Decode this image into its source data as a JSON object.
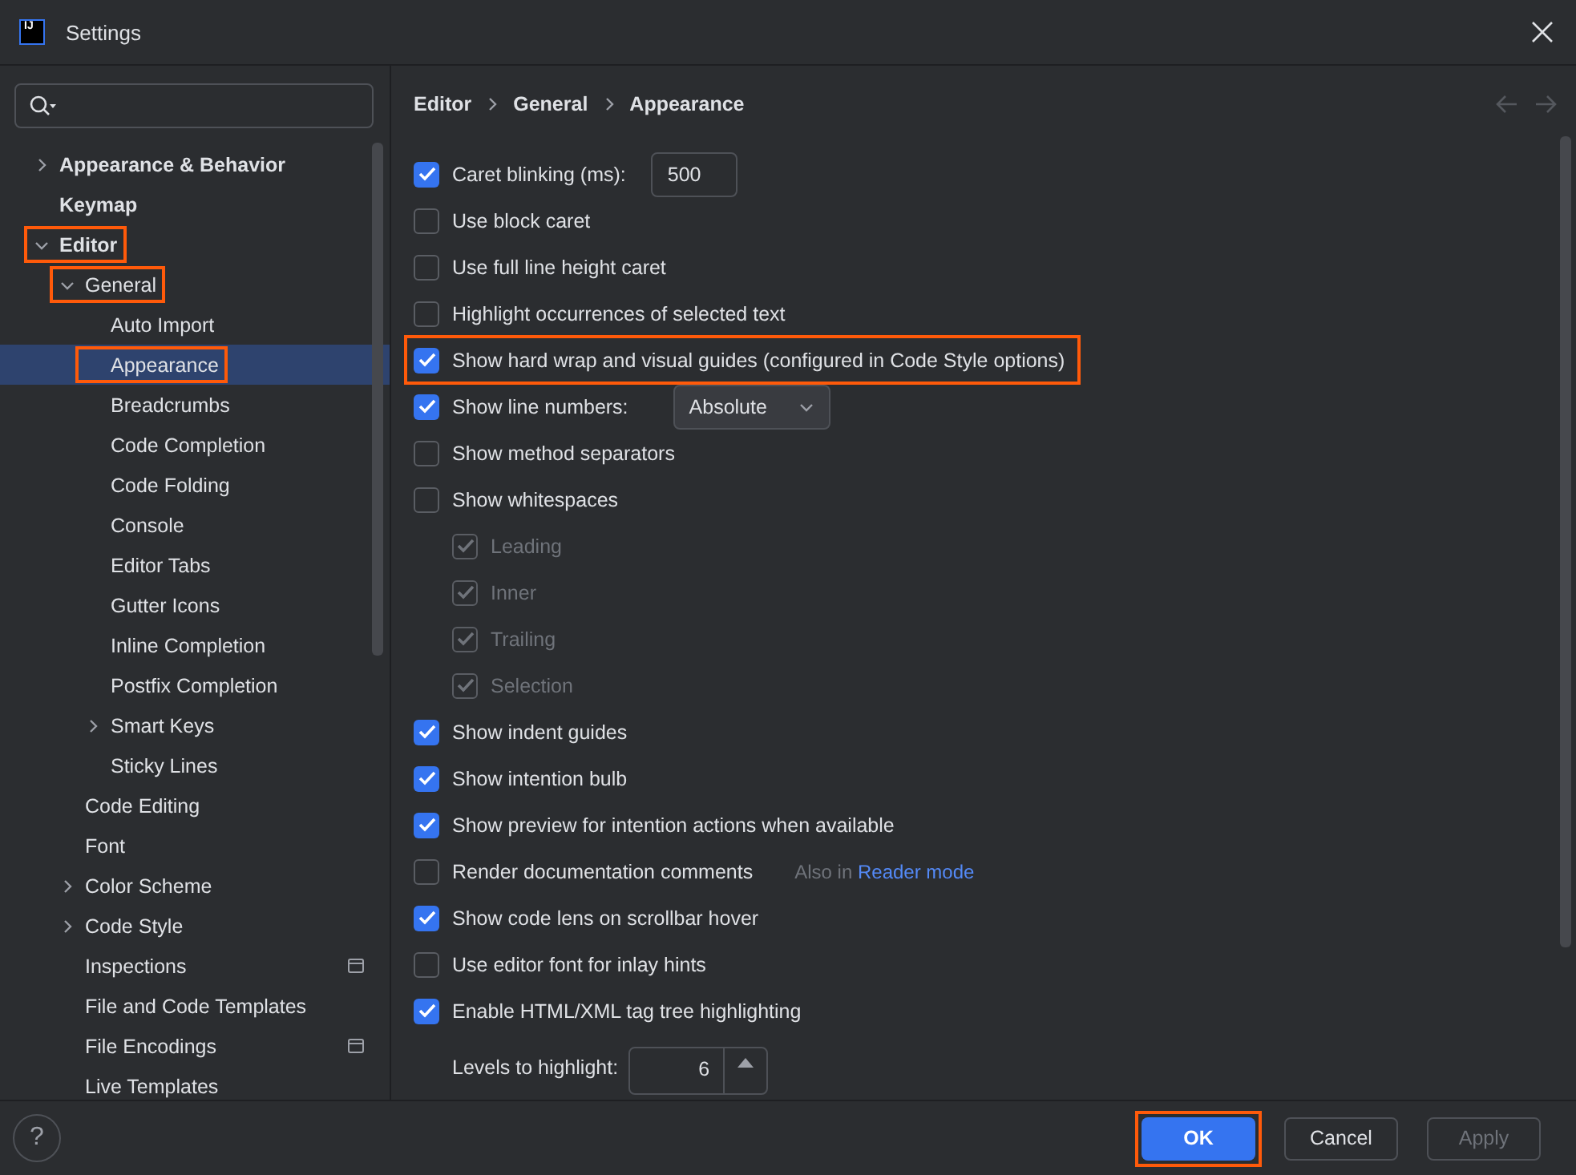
{
  "window": {
    "logo": "IJ",
    "title": "Settings"
  },
  "sidebar": {
    "items": [
      {
        "label": "Appearance & Behavior",
        "expanded": false,
        "selected": false,
        "highlighted": false
      },
      {
        "label": "Keymap",
        "selected": false,
        "highlighted": false
      },
      {
        "label": "Editor",
        "expanded": true,
        "selected": false,
        "highlighted": true,
        "children": [
          {
            "label": "General",
            "expanded": true,
            "selected": false,
            "highlighted": true,
            "children": [
              {
                "label": "Auto Import",
                "selected": false,
                "highlighted": false
              },
              {
                "label": "Appearance",
                "selected": true,
                "highlighted": true
              },
              {
                "label": "Breadcrumbs",
                "selected": false,
                "highlighted": false
              },
              {
                "label": "Code Completion",
                "selected": false,
                "highlighted": false
              },
              {
                "label": "Code Folding",
                "selected": false,
                "highlighted": false
              },
              {
                "label": "Console",
                "selected": false,
                "highlighted": false
              },
              {
                "label": "Editor Tabs",
                "selected": false,
                "highlighted": false
              },
              {
                "label": "Gutter Icons",
                "selected": false,
                "highlighted": false
              },
              {
                "label": "Inline Completion",
                "selected": false,
                "highlighted": false
              },
              {
                "label": "Postfix Completion",
                "selected": false,
                "highlighted": false
              },
              {
                "label": "Smart Keys",
                "expanded": false,
                "selected": false,
                "highlighted": false
              },
              {
                "label": "Sticky Lines",
                "selected": false,
                "highlighted": false
              }
            ]
          },
          {
            "label": "Code Editing",
            "selected": false,
            "highlighted": false
          },
          {
            "label": "Font",
            "selected": false,
            "highlighted": false
          },
          {
            "label": "Color Scheme",
            "expanded": false,
            "selected": false,
            "highlighted": false
          },
          {
            "label": "Code Style",
            "expanded": false,
            "selected": false,
            "highlighted": false
          },
          {
            "label": "Inspections",
            "selected": false,
            "highlighted": false,
            "scoped": true
          },
          {
            "label": "File and Code Templates",
            "selected": false,
            "highlighted": false
          },
          {
            "label": "File Encodings",
            "selected": false,
            "highlighted": false,
            "scoped": true
          },
          {
            "label": "Live Templates",
            "selected": false,
            "highlighted": false
          }
        ]
      }
    ]
  },
  "breadcrumbs": [
    "Editor",
    "General",
    "Appearance"
  ],
  "options": [
    {
      "kind": "checkbox",
      "label": "Caret blinking (ms):",
      "checked": true,
      "highlighted": false,
      "value": "500"
    },
    {
      "kind": "checkbox",
      "label": "Use block caret",
      "checked": false,
      "highlighted": false
    },
    {
      "kind": "checkbox",
      "label": "Use full line height caret",
      "checked": false,
      "highlighted": false
    },
    {
      "kind": "checkbox",
      "label": "Highlight occurrences of selected text",
      "checked": false,
      "highlighted": false
    },
    {
      "kind": "checkbox",
      "label": "Show hard wrap and visual guides (configured in Code Style options)",
      "checked": true,
      "highlighted": true
    },
    {
      "kind": "checkbox",
      "label": "Show line numbers:",
      "checked": true,
      "highlighted": false,
      "select": "Absolute"
    },
    {
      "kind": "checkbox",
      "label": "Show method separators",
      "checked": false,
      "highlighted": false
    },
    {
      "kind": "checkbox",
      "label": "Show whitespaces",
      "checked": false,
      "highlighted": false,
      "children": [
        {
          "label": "Leading",
          "checked": true,
          "disabled": true
        },
        {
          "label": "Inner",
          "checked": true,
          "disabled": true
        },
        {
          "label": "Trailing",
          "checked": true,
          "disabled": true
        },
        {
          "label": "Selection",
          "checked": true,
          "disabled": true
        }
      ]
    },
    {
      "kind": "checkbox",
      "label": "Show indent guides",
      "checked": true,
      "highlighted": false
    },
    {
      "kind": "checkbox",
      "label": "Show intention bulb",
      "checked": true,
      "highlighted": false
    },
    {
      "kind": "checkbox",
      "label": "Show preview for intention actions when available",
      "checked": true,
      "highlighted": false
    },
    {
      "kind": "checkbox",
      "label": "Render documentation comments",
      "checked": false,
      "highlighted": false,
      "note": "Also in",
      "link": "Reader mode"
    },
    {
      "kind": "checkbox",
      "label": "Show code lens on scrollbar hover",
      "checked": true,
      "highlighted": false
    },
    {
      "kind": "checkbox",
      "label": "Use editor font for inlay hints",
      "checked": false,
      "highlighted": false
    },
    {
      "kind": "checkbox",
      "label": "Enable HTML/XML tag tree highlighting",
      "checked": true,
      "highlighted": false
    },
    {
      "kind": "spinner",
      "label": "Levels to highlight:",
      "value": "6"
    }
  ],
  "help": {
    "label": "?"
  },
  "buttons": [
    {
      "label": "OK",
      "kind": "primary",
      "highlighted": true,
      "disabled": false
    },
    {
      "label": "Cancel",
      "kind": "secondary",
      "highlighted": false,
      "disabled": false
    },
    {
      "label": "Apply",
      "kind": "secondary",
      "highlighted": false,
      "disabled": true
    }
  ]
}
